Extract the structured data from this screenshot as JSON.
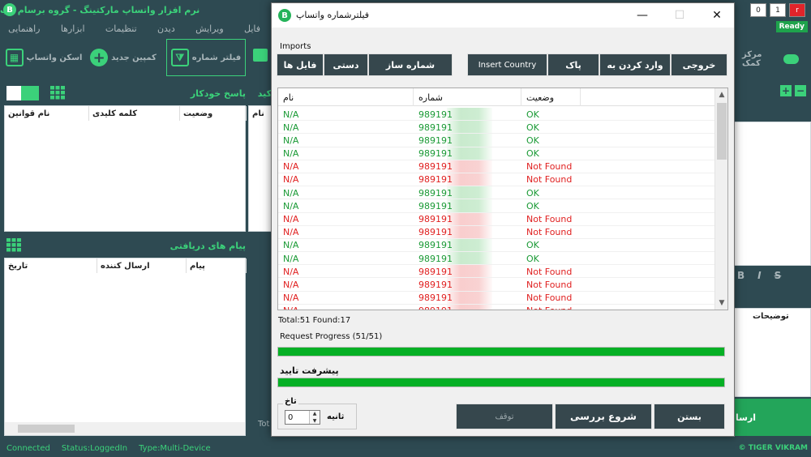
{
  "app": {
    "title": "نرم افزار واتساپ مارکتینگ - گروه برسام وب",
    "brand_letter": "B",
    "menu": [
      "فایل",
      "ویرایش",
      "دیدن",
      "تنظیمات",
      "ابزارها",
      "راهنمایی"
    ],
    "toolbar": {
      "scan_label": "اسکن واتساپ",
      "new_campaign_label": "کمپین جدید",
      "filter_label": "فیلتر شماره",
      "help_label": "مرکز کمک"
    },
    "autoreply": {
      "title": "پاسخ خودکار",
      "columns": [
        "نام قوانین",
        "کلمه کلیدی",
        "وضعیت"
      ],
      "side_col": "نام"
    },
    "incoming": {
      "title": "پیام های دریافتی",
      "columns": [
        "تاریخ",
        "ارسال کننده",
        "پیام"
      ]
    },
    "desc_col": "توضیحات",
    "send_label": "ارسا",
    "fmt_buttons": [
      "B",
      "I",
      "S"
    ],
    "status": [
      "Connected",
      "Status:LoggedIn",
      "Type:Multi-Device"
    ],
    "footer_brand": "© TIGER VIKRAM",
    "corner": [
      "0",
      "1",
      "r"
    ],
    "ready": "Ready",
    "partial_label": "کید",
    "tot_label": "Tot"
  },
  "dialog": {
    "title": "فیلترشماره واتساپ",
    "logo_letter": "B",
    "controls": {
      "minimize": "—",
      "maximize": "☐",
      "close": "✕"
    },
    "imports_label": "Imports",
    "left_buttons": [
      "فایل ها",
      "دستی",
      "شماره ساز"
    ],
    "right_buttons": [
      "Insert Country",
      "پاک",
      "وارد کردن به",
      "خروجی"
    ],
    "columns": [
      "نام",
      "شماره",
      "وضعیت"
    ],
    "rows": [
      {
        "name": "N/A",
        "number": "989191",
        "status": "OK"
      },
      {
        "name": "N/A",
        "number": "989191",
        "status": "OK"
      },
      {
        "name": "N/A",
        "number": "989191",
        "status": "OK"
      },
      {
        "name": "N/A",
        "number": "989191",
        "status": "OK"
      },
      {
        "name": "N/A",
        "number": "989191",
        "status": "Not Found"
      },
      {
        "name": "N/A",
        "number": "989191",
        "status": "Not Found"
      },
      {
        "name": "N/A",
        "number": "989191",
        "status": "OK"
      },
      {
        "name": "N/A",
        "number": "989191",
        "status": "OK"
      },
      {
        "name": "N/A",
        "number": "989191",
        "status": "Not Found"
      },
      {
        "name": "N/A",
        "number": "989191",
        "status": "Not Found"
      },
      {
        "name": "N/A",
        "number": "989191",
        "status": "OK"
      },
      {
        "name": "N/A",
        "number": "989191",
        "status": "OK"
      },
      {
        "name": "N/A",
        "number": "989191",
        "status": "Not Found"
      },
      {
        "name": "N/A",
        "number": "989191",
        "status": "Not Found"
      },
      {
        "name": "N/A",
        "number": "989191",
        "status": "Not Found"
      },
      {
        "name": "N/A",
        "number": "989191",
        "status": "Not Found"
      }
    ],
    "totals": "Total:51 Found:17",
    "request_progress_label": "Request Progress (51/51)",
    "request_progress": 1.0,
    "verify_label": "پیشرفت تایید",
    "verify_progress": 1.0,
    "delay_legend": "تاخ",
    "delay_value": "0",
    "seconds_label": "ثانیه",
    "stop_label": "توقف",
    "start_label": "شروع  بررسی",
    "close_label": "بستن"
  },
  "colors": {
    "accent": "#3bd17a",
    "ok": "#1a9a35",
    "not_found": "#e01f1f",
    "progress": "#06b025",
    "button_bg": "#36474d"
  }
}
